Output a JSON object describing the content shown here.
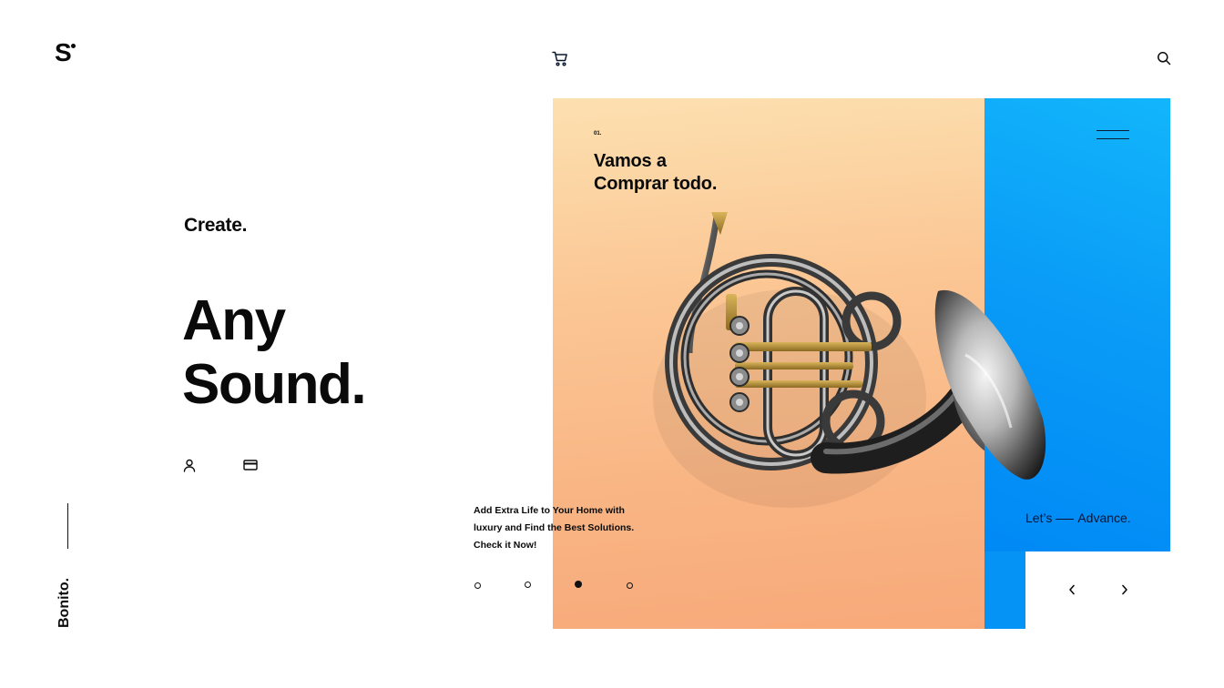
{
  "brand": {
    "logo_text": "S"
  },
  "header": {
    "cart_icon": "shopping-cart-icon",
    "search_icon": "search-icon"
  },
  "hero": {
    "kicker": "Create.",
    "headline_line1": "Any",
    "headline_line2": "Sound.",
    "icons": [
      "user-icon",
      "credit-card-icon"
    ]
  },
  "side": {
    "vertical_label": "Bonito."
  },
  "slide": {
    "number": "01.",
    "title_line1": "Vamos a",
    "title_line2": "Comprar todo.",
    "image": "french-horn"
  },
  "description": {
    "line1": "Add Extra Life to Your Home with",
    "line2": "luxury and Find the Best Solutions.",
    "line3": "Check it Now!"
  },
  "carousel": {
    "total": 4,
    "active_index": 2
  },
  "cta": {
    "left": "Let’s",
    "right": "Advance."
  },
  "colors": {
    "peach_top": "#fde0b0",
    "peach_bottom": "#f8a97a",
    "blue": "#0a9cf7",
    "text": "#0a0a0a"
  }
}
